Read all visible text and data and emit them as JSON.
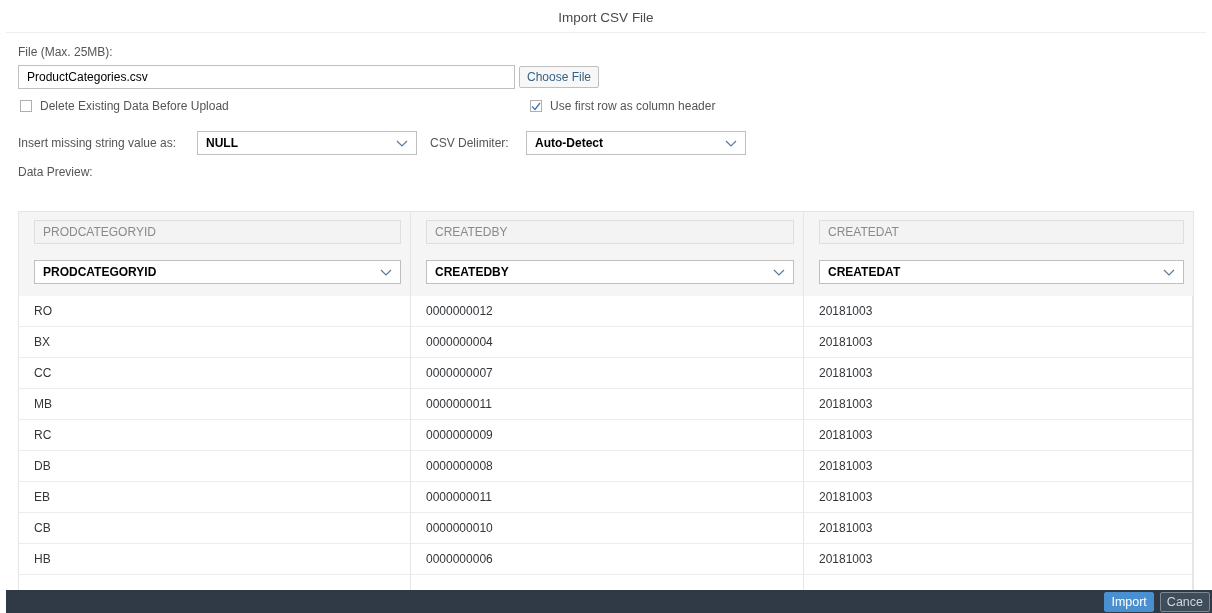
{
  "dialog": {
    "title": "Import CSV File"
  },
  "file": {
    "label": "File (Max. 25MB):",
    "value": "ProductCategories.csv",
    "button": "Choose File"
  },
  "options": [
    {
      "label": "Delete Existing Data Before Upload",
      "checked": false
    },
    {
      "label": "Use first row as column header",
      "checked": true
    }
  ],
  "missing_value": {
    "label": "Insert missing string value as:",
    "value": "NULL"
  },
  "delimiter": {
    "label": "CSV Delimiter:",
    "value": "Auto-Detect"
  },
  "preview": {
    "label": "Data Preview:",
    "columns": [
      {
        "source": "PRODCATEGORYID",
        "target": "PRODCATEGORYID"
      },
      {
        "source": "CREATEDBY",
        "target": "CREATEDBY"
      },
      {
        "source": "CREATEDAT",
        "target": "CREATEDAT"
      }
    ],
    "rows": [
      [
        "RO",
        "0000000012",
        "20181003"
      ],
      [
        "BX",
        "0000000004",
        "20181003"
      ],
      [
        "CC",
        "0000000007",
        "20181003"
      ],
      [
        "MB",
        "0000000011",
        "20181003"
      ],
      [
        "RC",
        "0000000009",
        "20181003"
      ],
      [
        "DB",
        "0000000008",
        "20181003"
      ],
      [
        "EB",
        "0000000011",
        "20181003"
      ],
      [
        "CB",
        "0000000010",
        "20181003"
      ],
      [
        "HB",
        "0000000006",
        "20181003"
      ]
    ]
  },
  "footer": {
    "buttons": [
      {
        "label": "Import",
        "kind": "primary"
      },
      {
        "label": "Cance",
        "kind": "secondary"
      }
    ]
  }
}
